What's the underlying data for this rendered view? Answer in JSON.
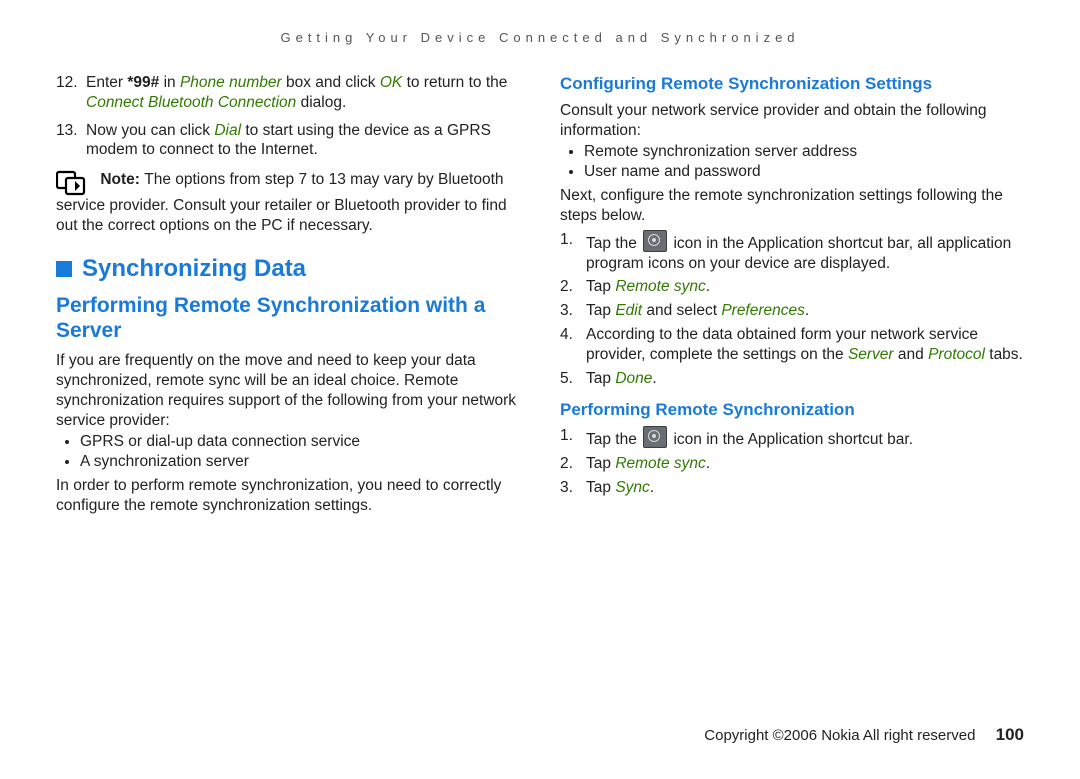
{
  "running_head": "Getting Your Device Connected and Synchronized",
  "left": {
    "step12_a": "Enter ",
    "step12_b": "*99#",
    "step12_c": " in ",
    "step12_d": "Phone number",
    "step12_e": " box and click ",
    "step12_f": "OK",
    "step12_g": " to return to the ",
    "step12_h": "Connect Bluetooth Connection",
    "step12_i": " dialog.",
    "step13_a": "Now you can click ",
    "step13_b": "Dial",
    "step13_c": " to start using the device as a GPRS modem to connect to the Internet.",
    "note_label": "Note: ",
    "note_body": "The options from step 7 to 13 may vary by Bluetooth service provider. Consult your retailer or Bluetooth provider to find out the correct options on the PC if necessary.",
    "h1": "Synchronizing Data",
    "h2": "Performing Remote Synchronization with a Server",
    "para1": "If you are frequently on the move and need to keep your data synchronized, remote sync will be an ideal choice. Remote synchronization requires support of the following from your network service provider:",
    "bul1": "GPRS or dial-up data connection service",
    "bul2": "A synchronization server",
    "para2": "In order to perform remote synchronization, you need to correctly configure the remote synchronization settings."
  },
  "right": {
    "h3a": "Configuring Remote Synchronization Settings",
    "para1": "Consult your network service provider and obtain the following information:",
    "bul1": "Remote synchronization server address",
    "bul2": "User name and password",
    "para2": "Next, configure the remote synchronization settings following the steps below.",
    "s1_a": "Tap the ",
    "s1_b": " icon in the Application shortcut bar, all application program icons on your device are displayed.",
    "s2_a": "Tap ",
    "s2_b": "Remote sync",
    "s2_c": ".",
    "s3_a": "Tap ",
    "s3_b": "Edit",
    "s3_c": " and select ",
    "s3_d": "Preferences",
    "s3_e": ".",
    "s4_a": "According to the data obtained form your network service provider, complete the settings on the ",
    "s4_b": "Server",
    "s4_c": " and ",
    "s4_d": "Protocol",
    "s4_e": " tabs.",
    "s5_a": "Tap ",
    "s5_b": "Done",
    "s5_c": ".",
    "h3b": "Performing Remote Synchronization",
    "p1_a": "Tap the ",
    "p1_b": " icon in the Application shortcut bar.",
    "p2_a": "Tap ",
    "p2_b": "Remote sync",
    "p2_c": ".",
    "p3_a": "Tap ",
    "p3_b": "Sync",
    "p3_c": "."
  },
  "footer": {
    "copyright": "Copyright ©2006 Nokia All right reserved",
    "page_number": "100"
  }
}
